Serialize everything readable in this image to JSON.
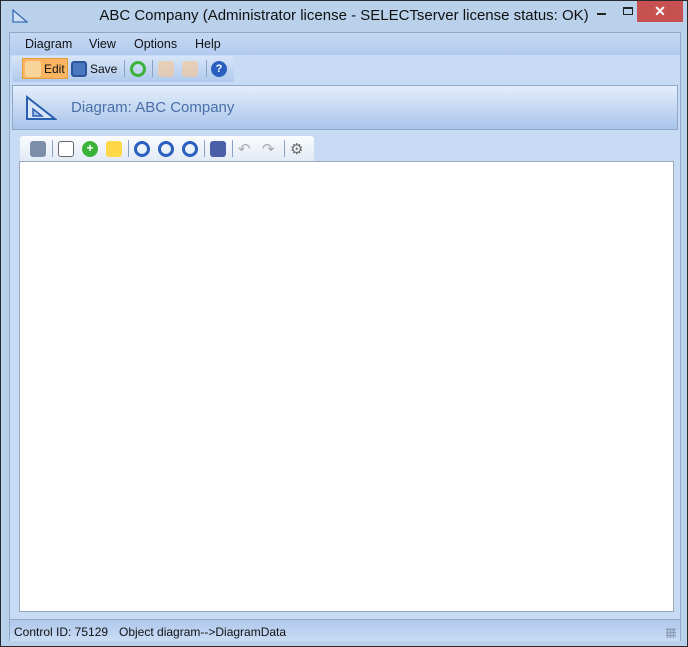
{
  "window": {
    "title": "ABC Company (Administrator license - SELECTserver license status: OK)",
    "close_glyph": "✕"
  },
  "menu": [
    "Diagram",
    "View",
    "Options",
    "Help"
  ],
  "toolbar": {
    "edit_label": "Edit",
    "save_label": "Save"
  },
  "header": {
    "title": "Diagram: ABC Company"
  },
  "status": {
    "control_id": "Control ID: 75129",
    "object": "Object diagram-->DiagramData"
  },
  "colors": {
    "accent": "#4a6fa8",
    "close": "#c75050",
    "edit_active": "#fbb562"
  }
}
